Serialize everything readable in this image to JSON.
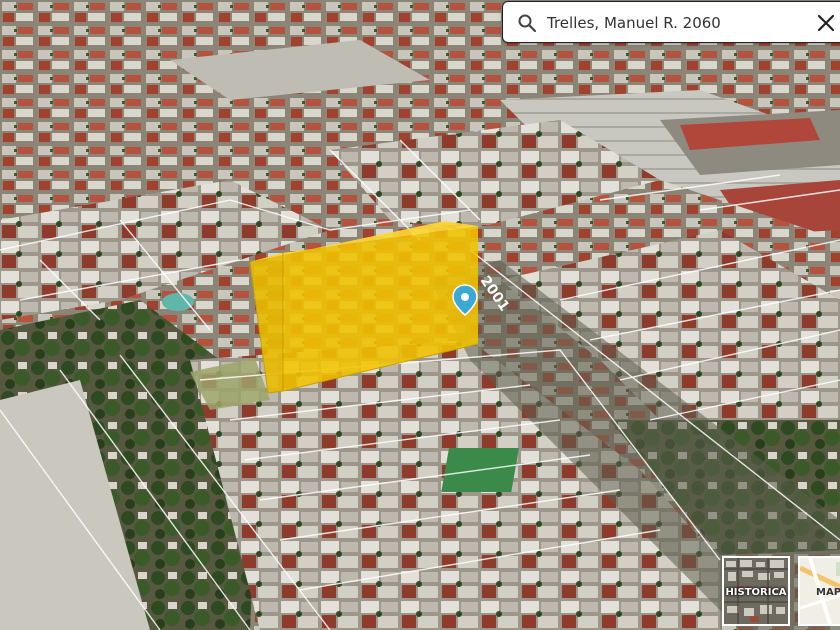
{
  "search": {
    "value": "Trelles, Manuel R. 2060",
    "icon": "search-icon",
    "clear_icon": "close-icon"
  },
  "map": {
    "street_label": "2001",
    "highlight_color": "#f2c300",
    "pin_color": "#3aa9d6"
  },
  "layers": {
    "historic_label": "HISTORICA",
    "map_label": "MAP"
  }
}
